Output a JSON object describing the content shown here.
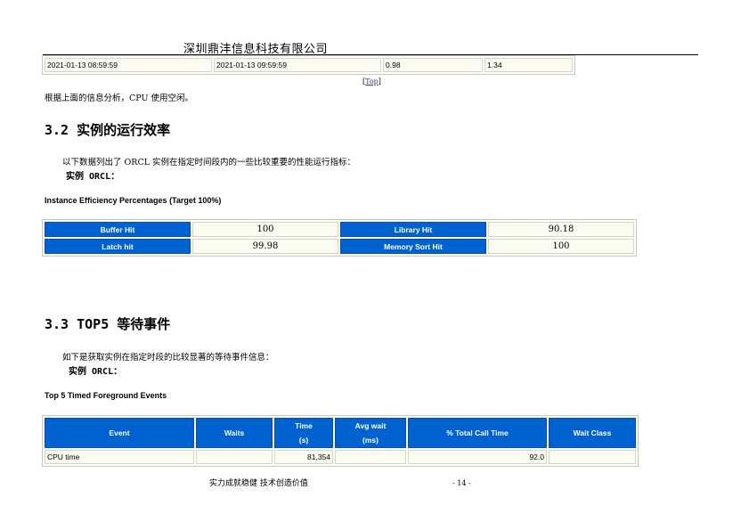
{
  "header": {
    "company": "深圳鼎沣信息科技有限公司"
  },
  "time_table": {
    "cells": [
      "2021-01-13 08:59:59",
      "2021-01-13 09:59:59",
      "0.98",
      "1.34"
    ]
  },
  "top_link": "Top",
  "analysis_text": "根据上面的信息分析，CPU 使用空闲。",
  "section_32": {
    "heading": "3.2 实例的运行效率",
    "intro": "以下数据列出了 ORCL 实例在指定时间段内的一些比较重要的性能运行指标：",
    "instance_label": "实例 ORCL：",
    "caption": "Instance Efficiency Percentages (Target 100%)",
    "rows": [
      {
        "l1": "Buffer Hit",
        "v1": "100",
        "l2": "Library Hit",
        "v2": "90.18"
      },
      {
        "l1": "Latch hit",
        "v1": "99.98",
        "l2": "Memory Sort Hit",
        "v2": "100"
      }
    ]
  },
  "section_33": {
    "heading": "3.3 TOP5 等待事件",
    "intro": "如下是获取实例在指定时段的比较显著的等待事件信息：",
    "instance_label": "实例 ORCL：",
    "caption": "Top 5 Timed Foreground Events",
    "headers": {
      "event": "Event",
      "waits": "Waits",
      "time_1": "Time",
      "time_2": "(s)",
      "avg_1": "Avg wait",
      "avg_2": "(ms)",
      "pct": "% Total Call Time",
      "wait_class": "Wait Class"
    },
    "rows": [
      {
        "event": "CPU time",
        "waits": "",
        "time": "81,354",
        "avg": "",
        "pct": "92.0",
        "wait_class": ""
      }
    ]
  },
  "footer": {
    "slogan": "实力成就稳健 技术创造价值",
    "page": "- 14 -"
  },
  "colors": {
    "header_blue": "#0062d1",
    "cell_bg": "#fbfbf2"
  }
}
